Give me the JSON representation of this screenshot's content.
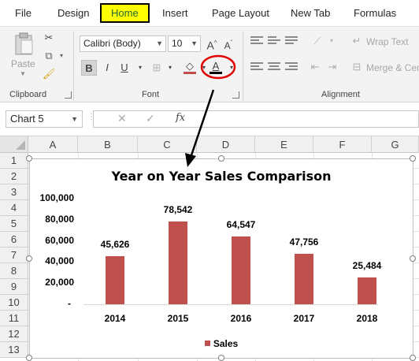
{
  "tabs": [
    "File",
    "Design",
    "Home",
    "Insert",
    "Page Layout",
    "New Tab",
    "Formulas"
  ],
  "ribbon": {
    "clipboard": {
      "paste_label": "Paste",
      "group_label": "Clipboard"
    },
    "font": {
      "font_name": "Calibri (Body)",
      "font_size": "10",
      "bold": "B",
      "italic": "I",
      "underline": "U",
      "font_color_glyph": "A",
      "grow_glyph": "A",
      "shrink_glyph": "A",
      "group_label": "Font"
    },
    "alignment": {
      "wrap_text": "Wrap Text",
      "merge_center": "Merge & Cen",
      "group_label": "Alignment"
    }
  },
  "formula_bar": {
    "name_box": "Chart 5",
    "fx": "fx"
  },
  "grid": {
    "columns": [
      "A",
      "B",
      "C",
      "D",
      "E",
      "F",
      "G"
    ],
    "rows": [
      "1",
      "2",
      "3",
      "4",
      "5",
      "6",
      "7",
      "8",
      "9",
      "10",
      "11",
      "12",
      "13"
    ]
  },
  "chart_data": {
    "type": "bar",
    "title": "Year on Year Sales Comparison",
    "categories": [
      "2014",
      "2015",
      "2016",
      "2017",
      "2018"
    ],
    "series": [
      {
        "name": "Sales",
        "values": [
          45626,
          78542,
          64547,
          47756,
          25484
        ]
      }
    ],
    "data_labels": [
      "45,626",
      "78,542",
      "64,547",
      "47,756",
      "25,484"
    ],
    "ytick_labels": [
      "100,000",
      "80,000",
      "60,000",
      "40,000",
      "20,000",
      "-"
    ],
    "ylim": [
      0,
      100000
    ],
    "grid": false,
    "legend": "bottom",
    "bar_color": "#c0504d"
  },
  "colors": {
    "home_highlight": "#ffff00",
    "annotation_red": "#e00000",
    "excel_green": "#1e6b3a"
  }
}
